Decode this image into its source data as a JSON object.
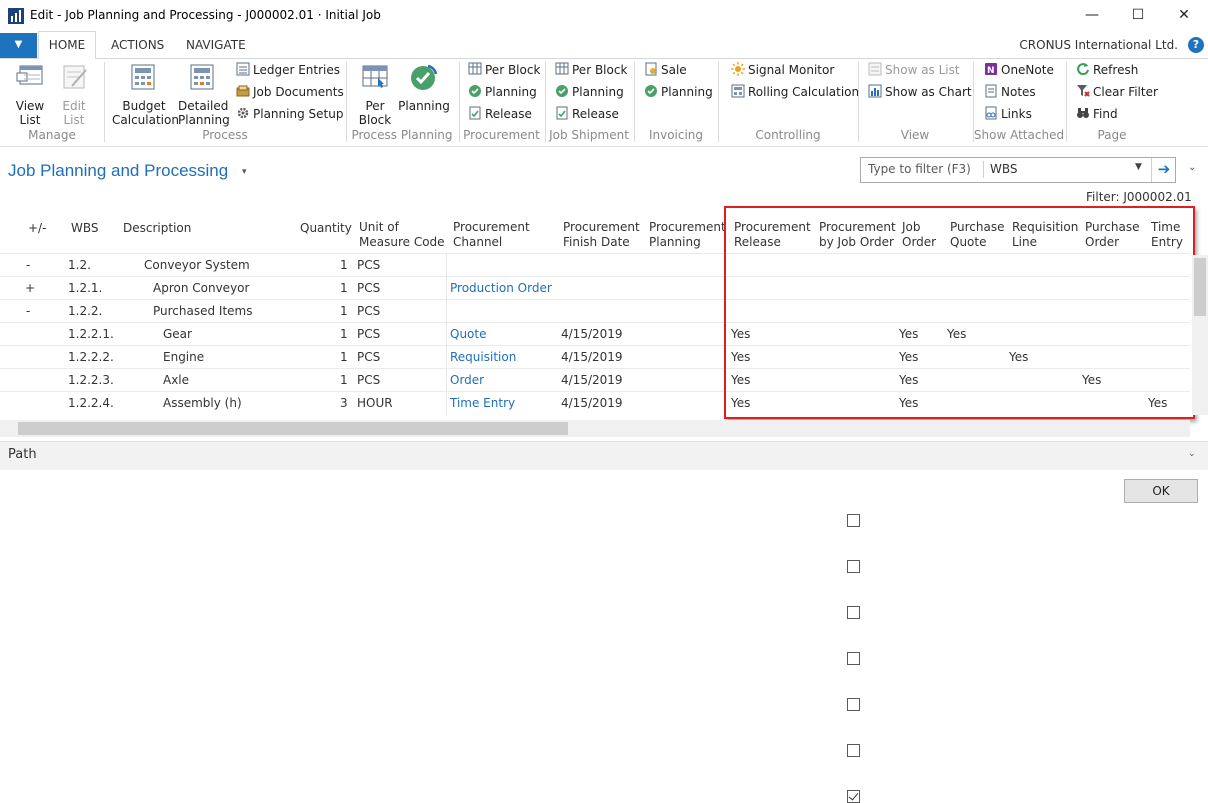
{
  "window": {
    "title": "Edit - Job Planning and Processing - J000002.01 · Initial Job",
    "minimize_glyph": "—",
    "maximize_glyph": "☐",
    "close_glyph": "✕"
  },
  "ribbon_tabs": [
    "HOME",
    "ACTIONS",
    "NAVIGATE"
  ],
  "app_menu_glyph": "▼",
  "company": "CRONUS International Ltd.",
  "help_glyph": "?",
  "ribbon": {
    "manage": {
      "label": "Manage",
      "view_list": "View List",
      "edit_list": "Edit List"
    },
    "process": {
      "label": "Process",
      "budget_calculation": "Budget Calculation",
      "detailed_planning": "Detailed Planning",
      "ledger_entries": "Ledger Entries",
      "job_documents": "Job Documents",
      "planning_setup": "Planning Setup"
    },
    "process_planning": {
      "label": "Process Planning",
      "per_block": "Per Block",
      "planning": "Planning"
    },
    "procurement": {
      "label": "Procurement",
      "per_block": "Per Block",
      "planning": "Planning",
      "release": "Release"
    },
    "job_shipment": {
      "label": "Job Shipment",
      "per_block": "Per Block",
      "planning": "Planning",
      "release": "Release"
    },
    "invoicing": {
      "label": "Invoicing",
      "sale": "Sale",
      "planning": "Planning"
    },
    "controlling": {
      "label": "Controlling",
      "signal_monitor": "Signal Monitor",
      "rolling_calculation": "Rolling Calculation"
    },
    "view": {
      "label": "View",
      "show_as_list": "Show as List",
      "show_as_chart": "Show as Chart"
    },
    "show_attached": {
      "label": "Show Attached",
      "onenote": "OneNote",
      "notes": "Notes",
      "links": "Links"
    },
    "page": {
      "label": "Page",
      "refresh": "Refresh",
      "clear_filter": "Clear Filter",
      "find": "Find"
    }
  },
  "page": {
    "title": "Job Planning and Processing",
    "title_arrow": "▾",
    "filter_placeholder": "Type to filter (F3)",
    "filter_field": "WBS",
    "filter_dropdown_glyph": "▼",
    "filter_go_glyph": "➔",
    "collapse_glyph": "⌄",
    "filter_label": "Filter: J000002.01"
  },
  "columns": {
    "expand": "+/-",
    "wbs": "WBS",
    "description": "Description",
    "quantity": "Quantity",
    "uom_1": "Unit of",
    "uom_2": "Measure Code",
    "proc_channel_1": "Procurement",
    "proc_channel_2": "Channel",
    "proc_finish_1": "Procurement",
    "proc_finish_2": "Finish Date",
    "proc_planning_1": "Procurement",
    "proc_planning_2": "Planning",
    "proc_release_1": "Procurement",
    "proc_release_2": "Release",
    "proc_by_job_1": "Procurement",
    "proc_by_job_2": "by Job Order",
    "job_order_1": "Job",
    "job_order_2": "Order",
    "purchase_quote_1": "Purchase",
    "purchase_quote_2": "Quote",
    "req_line_1": "Requisition",
    "req_line_2": "Line",
    "purchase_order_1": "Purchase",
    "purchase_order_2": "Order",
    "time_entry_1": "Time",
    "time_entry_2": "Entry"
  },
  "rows": [
    {
      "expand": "-",
      "wbs": "1.2.",
      "description": "Conveyor System",
      "quantity": "1",
      "uom": "PCS",
      "channel": "",
      "finish": "",
      "planning": "",
      "release": "",
      "by_job_order": false,
      "job_order": "",
      "purchase_quote": "",
      "req_line": "",
      "purchase_order": "",
      "time_entry": ""
    },
    {
      "expand": "+",
      "wbs": "1.2.1.",
      "description": "Apron Conveyor",
      "quantity": "1",
      "uom": "PCS",
      "channel": "Production Order",
      "finish": "",
      "planning": "",
      "release": "",
      "by_job_order": false,
      "job_order": "",
      "purchase_quote": "",
      "req_line": "",
      "purchase_order": "",
      "time_entry": ""
    },
    {
      "expand": "-",
      "wbs": "1.2.2.",
      "description": "Purchased Items",
      "quantity": "1",
      "uom": "PCS",
      "channel": "",
      "finish": "",
      "planning": "",
      "release": "",
      "by_job_order": false,
      "job_order": "",
      "purchase_quote": "",
      "req_line": "",
      "purchase_order": "",
      "time_entry": ""
    },
    {
      "expand": "",
      "wbs": "1.2.2.1.",
      "description": "Gear",
      "quantity": "1",
      "uom": "PCS",
      "channel": "Quote",
      "finish": "4/15/2019",
      "planning": "",
      "release": "Yes",
      "by_job_order": false,
      "job_order": "Yes",
      "purchase_quote": "Yes",
      "req_line": "",
      "purchase_order": "",
      "time_entry": ""
    },
    {
      "expand": "",
      "wbs": "1.2.2.2.",
      "description": "Engine",
      "quantity": "1",
      "uom": "PCS",
      "channel": "Requisition",
      "finish": "4/15/2019",
      "planning": "",
      "release": "Yes",
      "by_job_order": false,
      "job_order": "Yes",
      "purchase_quote": "",
      "req_line": "Yes",
      "purchase_order": "",
      "time_entry": ""
    },
    {
      "expand": "",
      "wbs": "1.2.2.3.",
      "description": "Axle",
      "quantity": "1",
      "uom": "PCS",
      "channel": "Order",
      "finish": "4/15/2019",
      "planning": "",
      "release": "Yes",
      "by_job_order": false,
      "job_order": "Yes",
      "purchase_quote": "",
      "req_line": "",
      "purchase_order": "Yes",
      "time_entry": ""
    },
    {
      "expand": "",
      "wbs": "1.2.2.4.",
      "description": "Assembly (h)",
      "quantity": "3",
      "uom": "HOUR",
      "channel": "Time Entry",
      "finish": "4/15/2019",
      "planning": "",
      "release": "Yes",
      "by_job_order": true,
      "job_order": "Yes",
      "purchase_quote": "",
      "req_line": "",
      "purchase_order": "",
      "time_entry": "Yes"
    }
  ],
  "footer": {
    "path_label": "Path",
    "path_chevron": "⌄",
    "ok": "OK"
  },
  "colors": {
    "accent": "#1e73be",
    "link": "#1e6fba",
    "highlight": "#e02020"
  }
}
